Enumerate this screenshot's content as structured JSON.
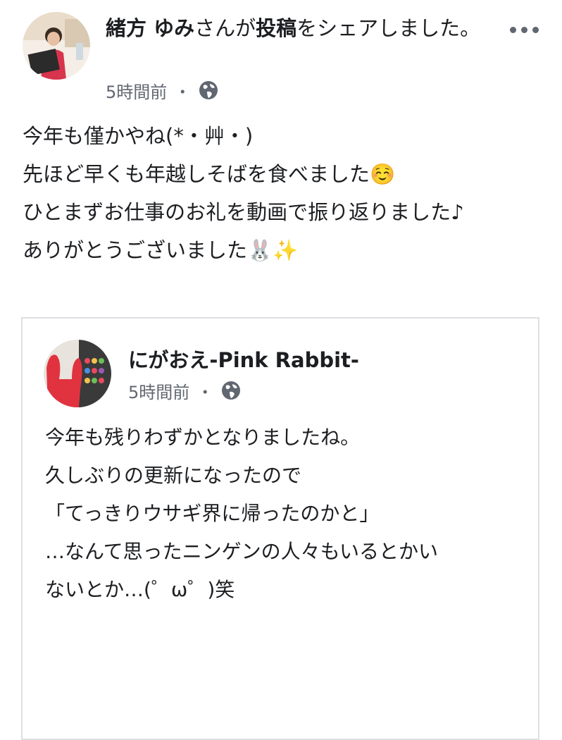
{
  "post": {
    "author_name": "緒方 ゆみ",
    "header_middle": "さんが",
    "shared_object": "投稿",
    "header_suffix": "をシェアしました。",
    "timestamp": "5時間前",
    "separator": "・",
    "privacy_icon": "globe-icon",
    "more_icon": "more-options-icon",
    "lines": [
      "今年も僅かやね(*・艸・)",
      "先ほど早くも年越しそばを食べました☺️",
      "",
      "ひとまずお仕事のお礼を動画で振り返りました♪",
      "ありがとうございました🐰✨"
    ]
  },
  "shared": {
    "page_name": "にがおえ-Pink Rabbit-",
    "timestamp": "5時間前",
    "separator": "・",
    "privacy_icon": "globe-icon",
    "lines": [
      "今年も残りわずかとなりましたね。",
      "",
      "久しぶりの更新になったので",
      "",
      "「てっきりウサギ界に帰ったのかと」",
      "",
      "…なんて思ったニンゲンの人々もいるとかい",
      "ないとか…(゜ω゜)笑"
    ]
  },
  "colors": {
    "text": "#1c1e21",
    "secondary": "#606770",
    "border": "#dddfe2"
  }
}
